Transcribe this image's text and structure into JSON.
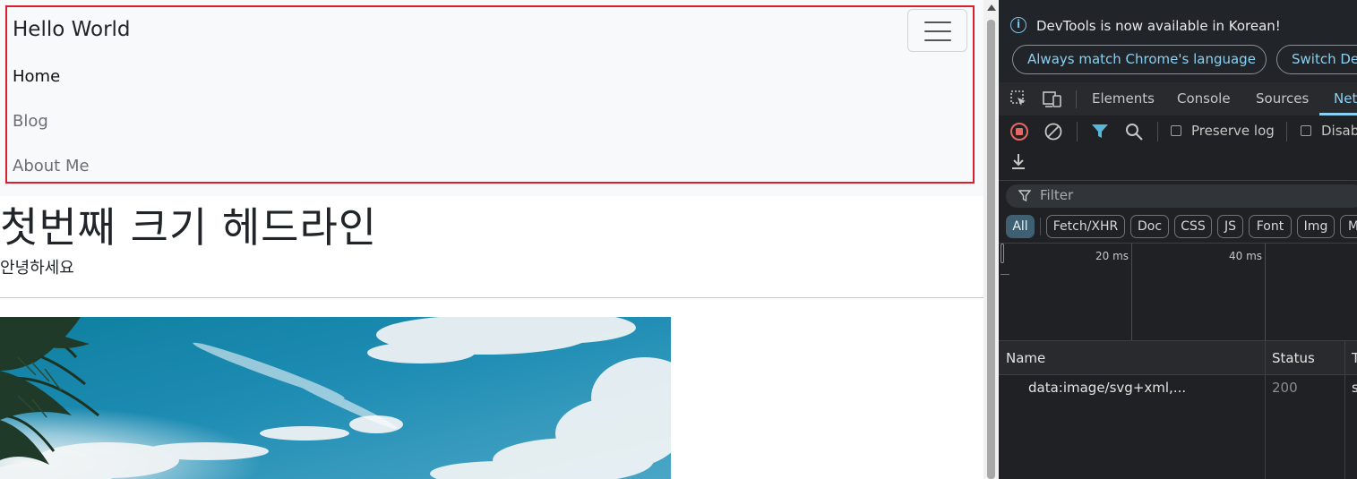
{
  "page": {
    "brand": "Hello World",
    "nav_items": [
      "Home",
      "Blog",
      "About Me"
    ],
    "headline": "첫번째 크기 헤드라인",
    "greeting": "안녕하세요",
    "hero_image": "beach-sky-palm-photo",
    "colors": {
      "highlight_outline": "#dc1f2e",
      "navbar_bg": "#f8f9fa"
    }
  },
  "devtools": {
    "banner": {
      "message": "DevTools is now available in Korean!",
      "match_button": "Always match Chrome's language",
      "switch_button": "Switch De"
    },
    "tabs": [
      "Elements",
      "Console",
      "Sources",
      "Net"
    ],
    "active_tab": "Network",
    "toolbar": {
      "preserve_log": "Preserve log",
      "disable_cache": "Disab"
    },
    "filter_placeholder": "Filter",
    "type_filters": [
      "All",
      "Fetch/XHR",
      "Doc",
      "CSS",
      "JS",
      "Font",
      "Img",
      "M"
    ],
    "active_filter": "All",
    "timeline_ticks": [
      "20 ms",
      "40 ms"
    ],
    "columns": [
      "Name",
      "Status",
      "T"
    ],
    "requests": [
      {
        "name": "data:image/svg+xml,...",
        "status": "200",
        "type": "s"
      }
    ],
    "colors": {
      "accent": "#8ad0f2",
      "record": "#e46962",
      "filter_funnel": "#58b7d8"
    }
  }
}
